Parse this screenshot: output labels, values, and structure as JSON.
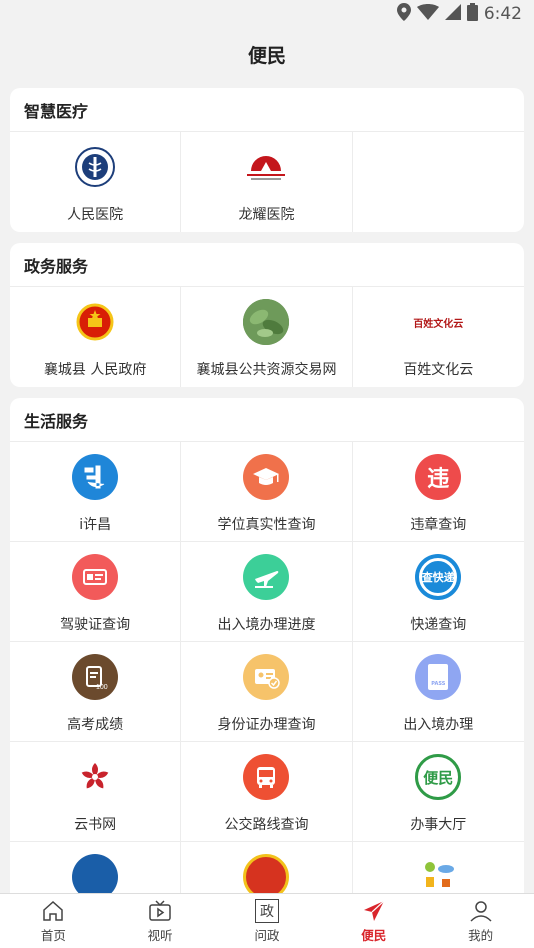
{
  "status": {
    "time": "6:42"
  },
  "header": {
    "title": "便民"
  },
  "sections": [
    {
      "title": "智慧医疗",
      "items": [
        {
          "label": "人民医院",
          "icon": "hospital-emblem-icon"
        },
        {
          "label": "龙耀医院",
          "icon": "longyao-logo-icon"
        }
      ]
    },
    {
      "title": "政务服务",
      "items": [
        {
          "label": "襄城县 人民政府",
          "icon": "national-emblem-icon"
        },
        {
          "label": "襄城县公共资源交易网",
          "icon": "leaf-photo-icon"
        },
        {
          "label": "百姓文化云",
          "icon": "baixing-culture-logo-icon",
          "logo_text": "百姓文化云"
        }
      ]
    },
    {
      "title": "生活服务",
      "items": [
        {
          "label": "i许昌",
          "icon": "ixuchang-icon",
          "color": "#1f86d8"
        },
        {
          "label": "学位真实性查询",
          "icon": "graduation-cap-icon",
          "color": "#f0714b"
        },
        {
          "label": "违章查询",
          "icon": "violation-icon",
          "color": "#ee4b4b",
          "glyph": "违"
        },
        {
          "label": "驾驶证查询",
          "icon": "driver-license-icon",
          "color": "#f25a5a"
        },
        {
          "label": "出入境办理进度",
          "icon": "airplane-icon",
          "color": "#3ccf98"
        },
        {
          "label": "快递查询",
          "icon": "express-search-icon",
          "color": "#1a8ad9",
          "glyph": "查快递"
        },
        {
          "label": "高考成绩",
          "icon": "exam-score-icon",
          "color": "#6b4a2d"
        },
        {
          "label": "身份证办理查询",
          "icon": "id-card-icon",
          "color": "#f6c36a"
        },
        {
          "label": "出入境办理",
          "icon": "passport-icon",
          "color": "#8fa6f2",
          "glyph": "PASS"
        },
        {
          "label": "云书网",
          "icon": "yunshu-logo-icon",
          "color": "#c8232c"
        },
        {
          "label": "公交路线查询",
          "icon": "bus-icon",
          "color": "#ee5033"
        },
        {
          "label": "办事大厅",
          "icon": "bianmin-hall-icon",
          "color": "#2f9b47",
          "glyph": "便民"
        },
        {
          "label": "",
          "icon": "partial-blue-logo-icon",
          "color": "#1a5ea8"
        },
        {
          "label": "",
          "icon": "partial-exam-logo-icon",
          "color": "#d6331f"
        },
        {
          "label": "",
          "icon": "partial-cartoon-icon",
          "color": "#f2b41c"
        }
      ]
    }
  ],
  "tabbar": [
    {
      "label": "首页",
      "icon": "home-icon"
    },
    {
      "label": "视听",
      "icon": "tv-icon"
    },
    {
      "label": "问政",
      "icon": "government-icon",
      "glyph": "政"
    },
    {
      "label": "便民",
      "icon": "paper-plane-icon",
      "active": true
    },
    {
      "label": "我的",
      "icon": "user-icon"
    }
  ],
  "accent": "#d9262c"
}
